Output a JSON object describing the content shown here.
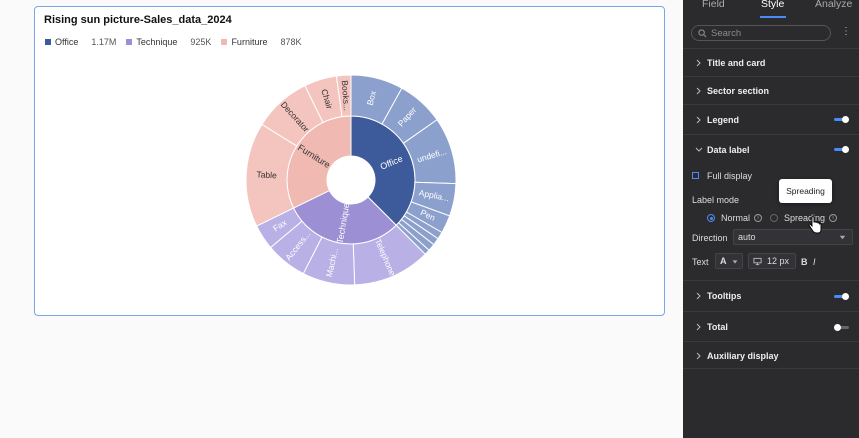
{
  "chart_card": {
    "title": "Rising sun picture-Sales_data_2024",
    "legend": [
      {
        "label": "Office",
        "value": "1.17M",
        "color": "#3d5a9b"
      },
      {
        "label": "Technique",
        "value": "925K",
        "color": "#9d8fd3"
      },
      {
        "label": "Furniture",
        "value": "878K",
        "color": "#f0b9b2"
      }
    ]
  },
  "chart_data": {
    "type": "sunburst",
    "title": "Rising sun picture-Sales_data_2024",
    "inner": [
      {
        "name": "Office",
        "value": 1170000,
        "color": "#3d5a9b"
      },
      {
        "name": "Technique",
        "value": 925000,
        "color": "#9d8fd3"
      },
      {
        "name": "Furniture",
        "value": 878000,
        "color": "#f0b9b2"
      }
    ],
    "outer": [
      {
        "name": "Box",
        "parent": "Office"
      },
      {
        "name": "Paper",
        "parent": "Office"
      },
      {
        "name": "undefi...",
        "parent": "Office"
      },
      {
        "name": "Applia...",
        "parent": "Office"
      },
      {
        "name": "Pen",
        "parent": "Office"
      },
      {
        "name": "",
        "parent": "Office"
      },
      {
        "name": "",
        "parent": "Office"
      },
      {
        "name": "",
        "parent": "Office"
      },
      {
        "name": "",
        "parent": "Office"
      },
      {
        "name": "Telephone",
        "parent": "Technique"
      },
      {
        "name": "Machi...",
        "parent": "Technique"
      },
      {
        "name": "Access...",
        "parent": "Technique"
      },
      {
        "name": "Fax",
        "parent": "Technique"
      },
      {
        "name": "Table",
        "parent": "Furniture"
      },
      {
        "name": "Decorator",
        "parent": "Furniture"
      },
      {
        "name": "Chair",
        "parent": "Furniture"
      },
      {
        "name": "Books...",
        "parent": "Furniture"
      }
    ],
    "outer_colors": {
      "Office": "#8ba0cc",
      "Technique": "#b9b0e6",
      "Furniture": "#f4c4be"
    }
  },
  "panel": {
    "tabs": [
      "Field",
      "Style",
      "Analyze"
    ],
    "active_tab": "Style",
    "search_placeholder": "Search",
    "sections": {
      "title_and_card": "Title and card",
      "sector_section": "Sector section",
      "legend": "Legend",
      "data_label": "Data label",
      "tooltips": "Tooltips",
      "total": "Total",
      "auxiliary_display": "Auxiliary display"
    },
    "toggles": {
      "legend": true,
      "data_label": true,
      "tooltips": true,
      "total": false
    },
    "data_label": {
      "full_display": "Full display",
      "full_display_checked": false,
      "label_mode": "Label mode",
      "mode_normal": "Normal",
      "mode_spreading": "Spreading",
      "selected_mode": "Normal",
      "direction_label": "Direction",
      "direction_value": "auto",
      "text_label": "Text",
      "font_sample": "A",
      "font_size": "12 px",
      "bold": "B",
      "italic": "I"
    },
    "tooltip_text": "Spreading"
  }
}
